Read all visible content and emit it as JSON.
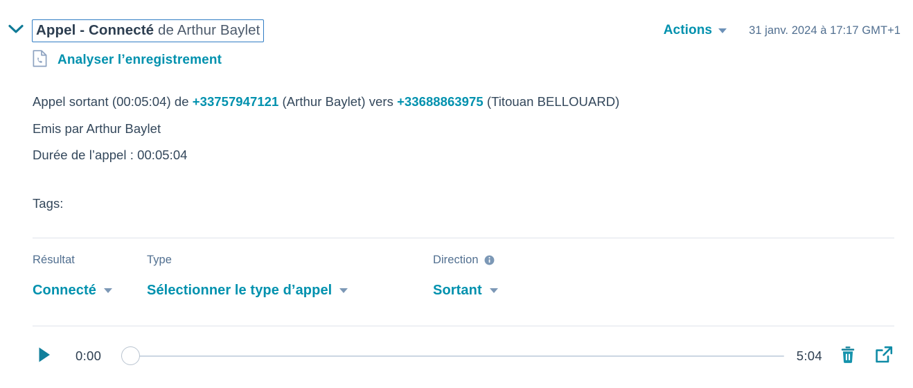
{
  "header": {
    "collapse_icon": "chevron-down-icon",
    "title_strong": "Appel - Connecté",
    "title_regular": " de Arthur Baylet",
    "actions_label": "Actions",
    "actions_caret_icon": "caret-down-icon",
    "timestamp": "31 janv. 2024 à 17:17 GMT+1"
  },
  "analyse": {
    "icon": "document-phone-icon",
    "label": "Analyser l’enregistrement"
  },
  "details": {
    "line1_prefix": "Appel sortant (00:05:04) de ",
    "line1_phone_from": "+33757947121",
    "line1_middle": " (Arthur Baylet) vers ",
    "line1_phone_to": "+33688863975",
    "line1_suffix": " (Titouan BELLOUARD)",
    "line2": "Emis par Arthur Baylet",
    "line3": "Durée de l’appel : 00:05:04"
  },
  "tags": {
    "label": "Tags:"
  },
  "properties": [
    {
      "name": "result",
      "label": "Résultat",
      "value": "Connecté",
      "caret_icon": "caret-down-icon",
      "has_info": false
    },
    {
      "name": "type",
      "label": "Type",
      "value": "Sélectionner le type d’appel",
      "caret_icon": "caret-down-icon",
      "has_info": false
    },
    {
      "name": "direction",
      "label": "Direction",
      "value": "Sortant",
      "caret_icon": "caret-down-icon",
      "has_info": true,
      "info_icon": "info-icon"
    }
  ],
  "player": {
    "play_icon": "play-icon",
    "current_time": "0:00",
    "total_time": "5:04",
    "progress_percent": 0,
    "delete_icon": "trash-icon",
    "popout_icon": "external-link-icon"
  },
  "colors": {
    "teal": "#0091ae",
    "text": "#33475b",
    "muted": "#516f90",
    "border": "#dfe3eb",
    "focus_border": "#2f7cc4",
    "slider_track": "#cbd6e2"
  }
}
